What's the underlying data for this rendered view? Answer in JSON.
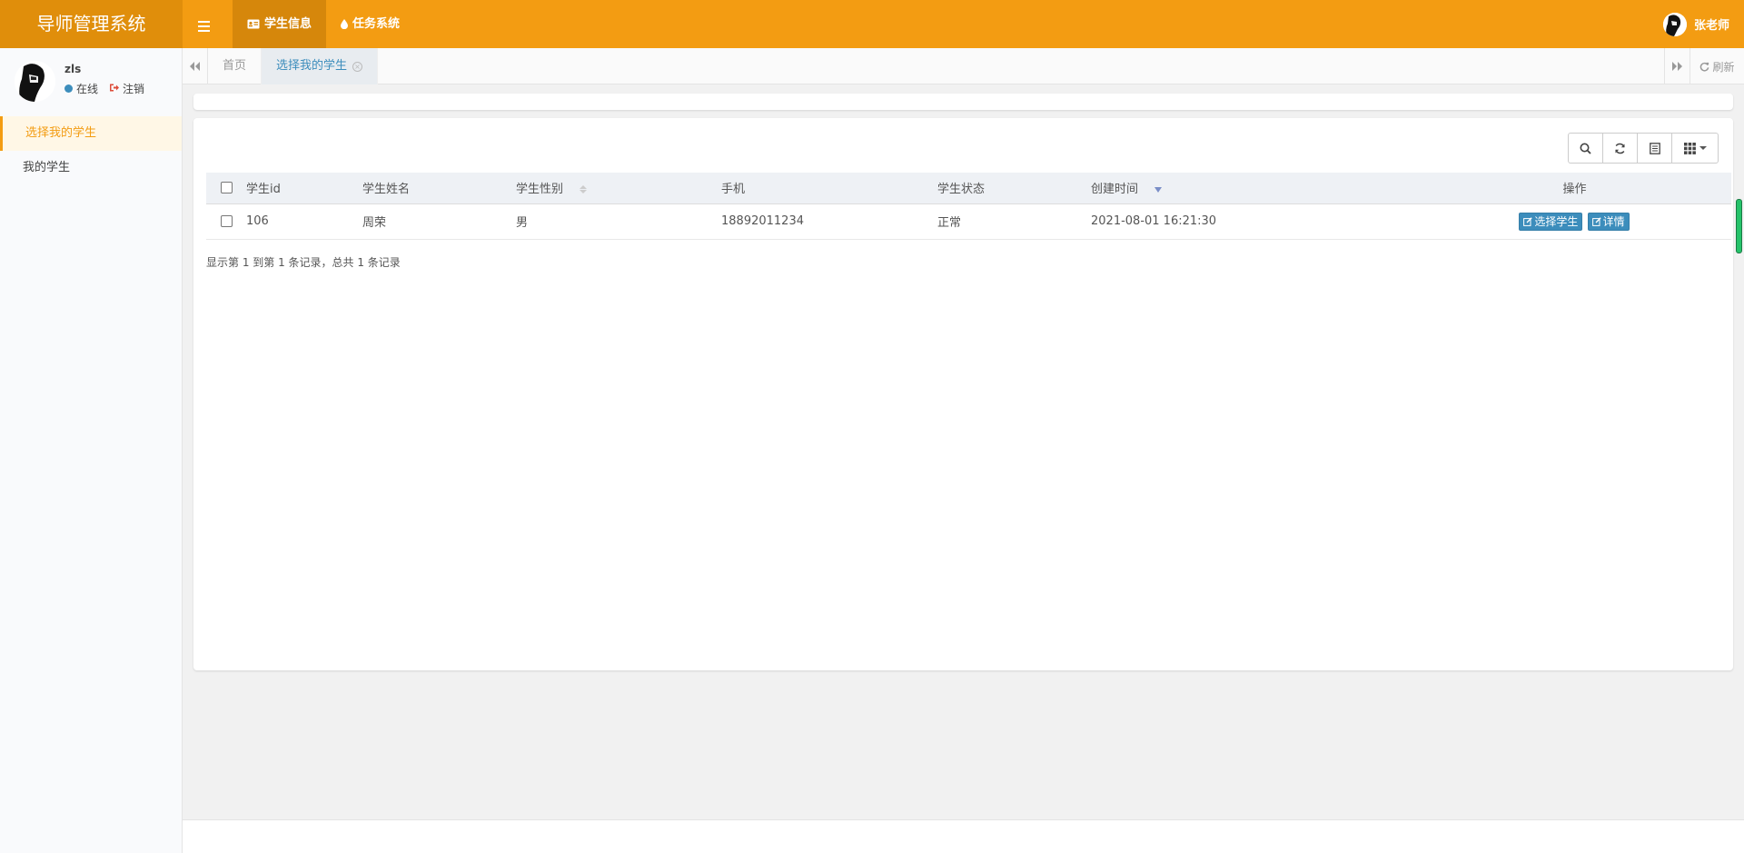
{
  "app": {
    "title": "导师管理系统"
  },
  "topnav": {
    "items": [
      {
        "label": "学生信息",
        "icon": "id-card-icon",
        "active": true
      },
      {
        "label": "任务系统",
        "icon": "drop-icon",
        "active": false
      }
    ],
    "user": "张老师"
  },
  "sidebar": {
    "user_name": "zls",
    "status": "在线",
    "logout": "注销",
    "menu": [
      {
        "label": "选择我的学生",
        "active": true
      },
      {
        "label": "我的学生",
        "active": false
      }
    ]
  },
  "tabs": {
    "items": [
      {
        "label": "首页",
        "active": false
      },
      {
        "label": "选择我的学生",
        "active": true
      }
    ],
    "refresh": "刷新"
  },
  "table": {
    "columns": [
      "学生id",
      "学生姓名",
      "学生性别",
      "手机",
      "学生状态",
      "创建时间",
      "操作"
    ],
    "rows": [
      {
        "id": "106",
        "name": "周荣",
        "gender": "男",
        "phone": "18892011234",
        "status": "正常",
        "created": "2021-08-01 16:21:30",
        "actions": [
          "选择学生",
          "详情"
        ]
      }
    ],
    "summary": "显示第 1 到第 1 条记录，总共 1 条记录"
  },
  "colors": {
    "header": "#f39c12",
    "logo_bg": "#e08e0b",
    "primary": "#3c8dbc"
  }
}
